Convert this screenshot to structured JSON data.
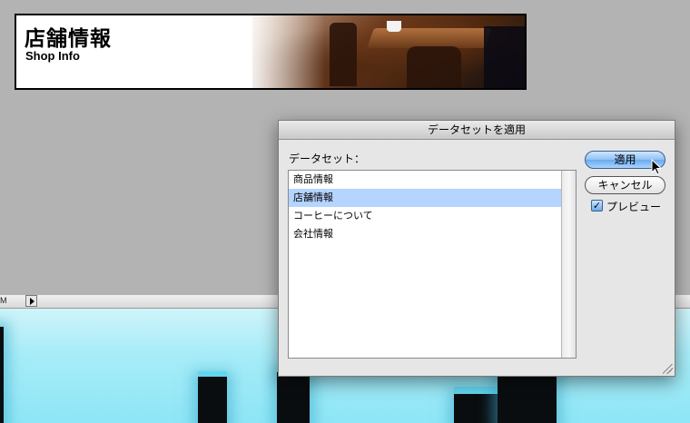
{
  "banner": {
    "title": "店舗情報",
    "subtitle": "Shop Info"
  },
  "bottom_strip": {
    "left_text": "M"
  },
  "dialog": {
    "title": "データセットを適用",
    "dataset_label": "データセット：",
    "datasets": [
      "商品情報",
      "店舗情報",
      "コーヒーについて",
      "会社情報"
    ],
    "selected_index": 1,
    "apply_button": "適用",
    "cancel_button": "キャンセル",
    "preview_label": "プレビュー",
    "preview_checked": true
  },
  "colors": {
    "selection": "#b5d4ff",
    "default_button": "#6aa9ee",
    "cyan_background": "#a7ecf8"
  }
}
